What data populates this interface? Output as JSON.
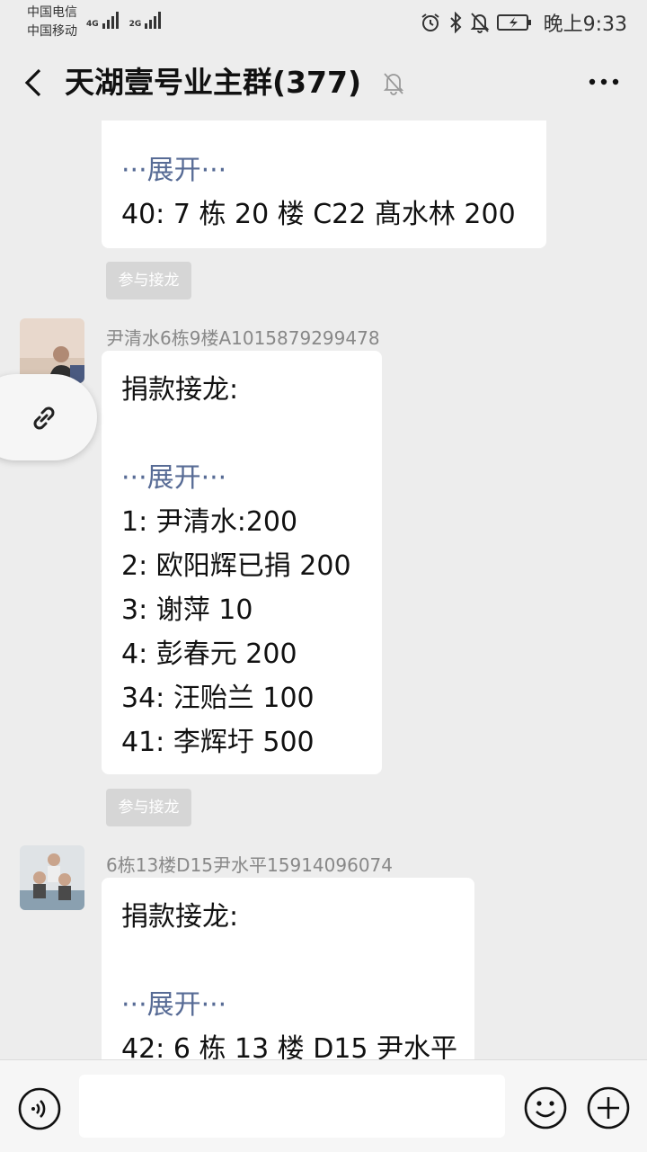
{
  "status_bar": {
    "carrier1": "中国电信",
    "carrier2": "中国移动",
    "net1": "4G",
    "net2": "2G",
    "time": "晚上9:33",
    "icons": [
      "alarm-icon",
      "bluetooth-icon",
      "bell-off-icon",
      "battery-charging-icon"
    ]
  },
  "nav": {
    "title": "天湖壹号业主群(377)",
    "icons": [
      "back-chevron-icon",
      "mute-bell-icon",
      "more-dots-icon"
    ]
  },
  "chat": {
    "msg1": {
      "expand": "···展开···",
      "lines": [
        "40: 7 栋 20 楼 C22 髙水林   200"
      ]
    },
    "jielong_label": "参与接龙",
    "msg2": {
      "sender": "尹清水6栋9楼A1015879299478",
      "heading": "捐款接龙:",
      "expand": "···展开···",
      "lines": [
        "1: 尹清水:200",
        "2: 欧阳辉已捐 200",
        "3: 谢萍  10",
        "4: 彭春元 200",
        "34: 汪贻兰 100",
        "41: 李辉圩 500"
      ]
    },
    "msg3": {
      "sender": "6栋13楼D15尹水平15914096074",
      "heading": "捐款接龙:",
      "expand": "···展开···",
      "lines": [
        "42: 6 栋 13 楼 D15 尹水平"
      ]
    }
  },
  "input_bar": {
    "icons": [
      "voice-icon",
      "emoji-icon",
      "plus-icon"
    ]
  }
}
